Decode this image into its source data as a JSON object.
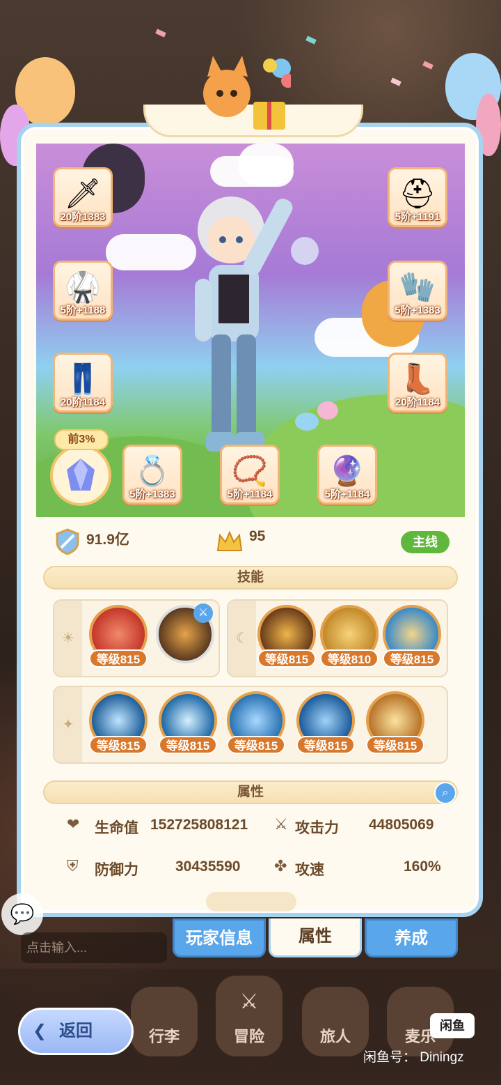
{
  "equipment": {
    "left": [
      {
        "glyph": "🗡",
        "level": "20阶1383",
        "name": "weapon"
      },
      {
        "glyph": "🥋",
        "level": "5阶+1188",
        "name": "armor"
      },
      {
        "glyph": "👖",
        "level": "20阶1184",
        "name": "pants"
      }
    ],
    "right": [
      {
        "glyph": "⛑",
        "level": "5阶+1191",
        "name": "helmet"
      },
      {
        "glyph": "🧤",
        "level": "5阶+1383",
        "name": "gloves"
      },
      {
        "glyph": "👢",
        "level": "20阶1184",
        "name": "boots"
      }
    ],
    "bottom": [
      {
        "glyph": "💍",
        "level": "5阶+1383",
        "name": "ring"
      },
      {
        "glyph": "📿",
        "level": "5阶+1184",
        "name": "necklace"
      },
      {
        "glyph": "🔮",
        "level": "5阶+1184",
        "name": "amulet"
      }
    ],
    "rank_tag": "前3%"
  },
  "stats": {
    "power": "91.9亿",
    "crown": "95",
    "mainline": "主线"
  },
  "skills_title": "技能",
  "skills_row1_left": [
    {
      "level": "等级815",
      "color": "#c4372b"
    },
    {
      "level": "",
      "color": "#5a3a20"
    }
  ],
  "skills_row1_right": [
    {
      "level": "等级815",
      "color": "#6a3c1c"
    },
    {
      "level": "等级810",
      "color": "#c28a2a"
    },
    {
      "level": "等级815",
      "color": "#3a8ac8"
    }
  ],
  "skills_row2": [
    {
      "level": "等级815",
      "color": "#1f5f9a"
    },
    {
      "level": "等级815",
      "color": "#1e6aa8"
    },
    {
      "level": "等级815",
      "color": "#2a74b4"
    },
    {
      "level": "等级815",
      "color": "#1d5c9c"
    },
    {
      "level": "等级815",
      "color": "#b8742a"
    }
  ],
  "attributes_title": "属性",
  "attributes": {
    "hp_label": "生命值",
    "hp_value": "152725808121",
    "atk_label": "攻击力",
    "atk_value": "44805069",
    "def_label": "防御力",
    "def_value": "30435590",
    "spd_label": "攻速",
    "spd_value": "160%"
  },
  "tabs": {
    "player_info": "玩家信息",
    "attributes": "属性",
    "develop": "养成"
  },
  "chat_placeholder": "点击输入...",
  "nav": {
    "bag": "行李",
    "adventure": "冒险",
    "traveler": "旅人",
    "mailer": "麦乐"
  },
  "back_label": "返回",
  "watermark": {
    "logo": "闲鱼",
    "text": "闲鱼号： Diningz"
  }
}
